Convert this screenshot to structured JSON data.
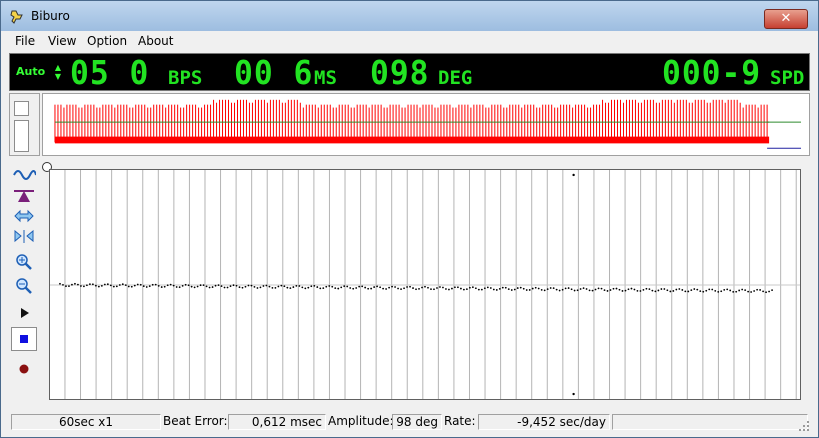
{
  "window": {
    "title": "Biburo",
    "close_glyph": "✕"
  },
  "menu": {
    "items": [
      "File",
      "View",
      "Option",
      "About"
    ]
  },
  "lcd": {
    "mode": "Auto",
    "bps_value": "05 0",
    "bps_unit": "BPS",
    "ms_value": "00 6",
    "ms_unit": "MS",
    "deg_value": "098",
    "deg_unit": "DEG",
    "spd_value": "000-9",
    "spd_unit": "SPD",
    "color": "#22e322"
  },
  "toolbar": {
    "icons": [
      "sine-wave-icon",
      "balance-icon",
      "expand-horizontal-icon",
      "compress-horizontal-icon",
      "zoom-in-icon",
      "zoom-out-icon",
      "play-icon",
      "stop-icon",
      "record-icon"
    ]
  },
  "status": {
    "timebase": "60sec x1",
    "beat_error_label": "Beat Error:",
    "beat_error_value": "0,612 msec",
    "amplitude_label": "Amplitude:",
    "amplitude_value": "98 deg",
    "rate_label": "Rate:",
    "rate_value": "-9,452 sec/day"
  },
  "colors": {
    "waveform": "#ff0000",
    "grid": "#b4b4b4",
    "lcd_background": "#000000",
    "baseline": "#2d8a2d"
  }
}
